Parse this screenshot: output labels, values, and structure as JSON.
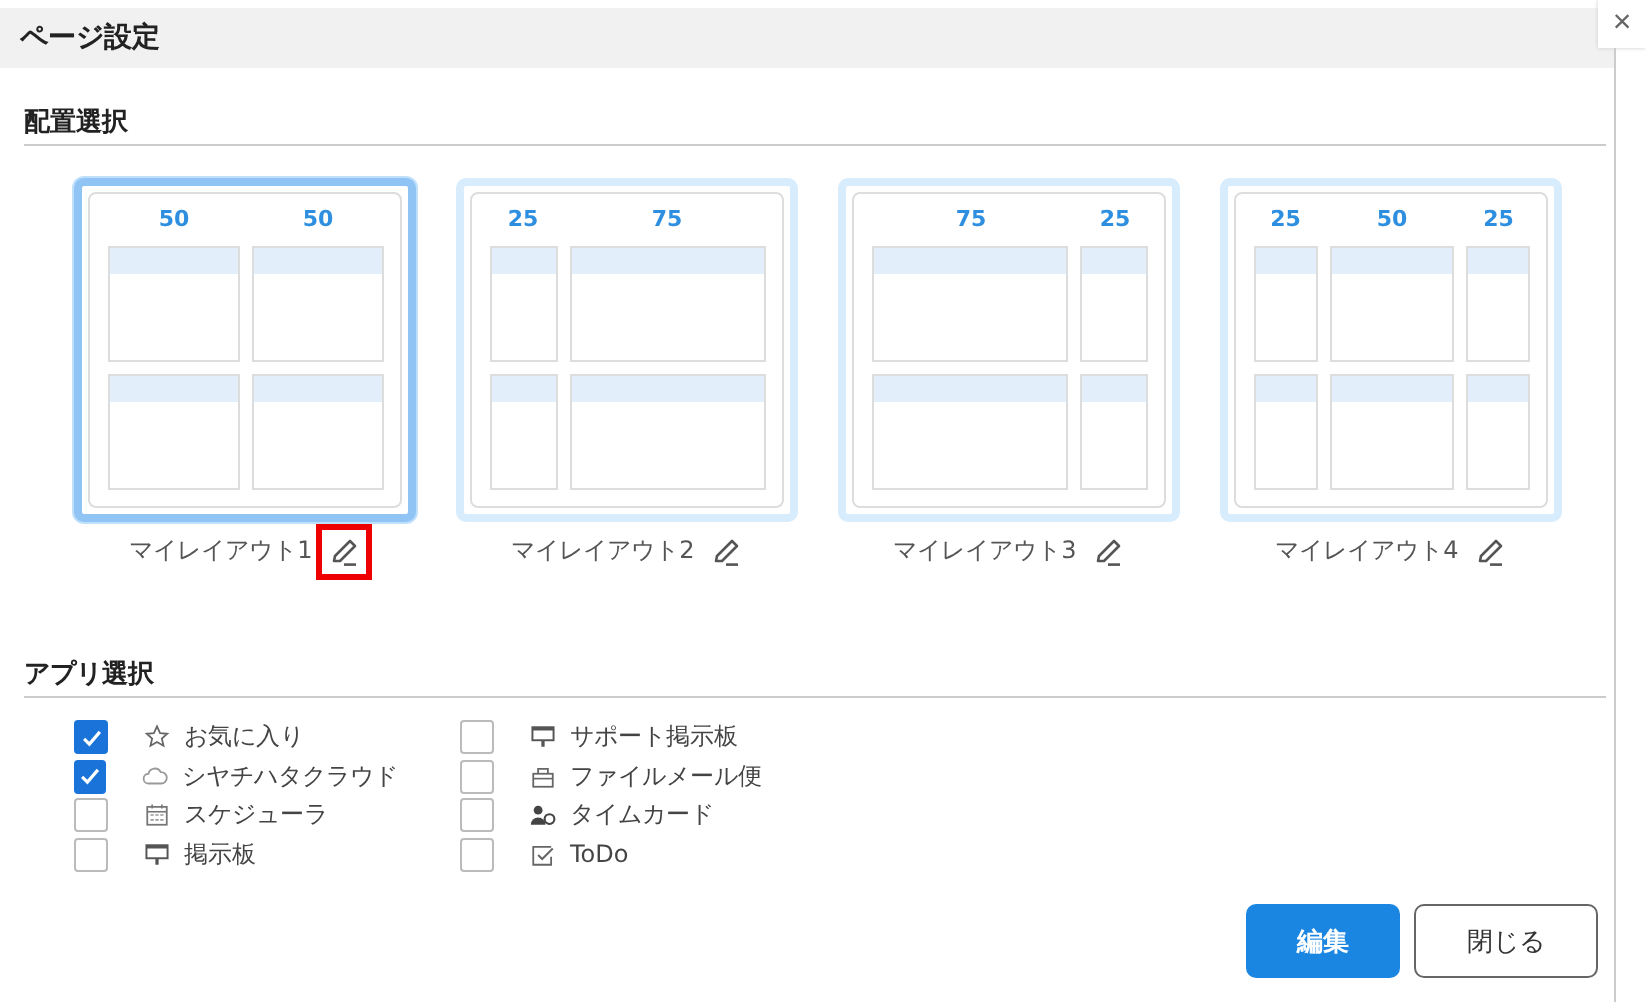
{
  "dialog": {
    "title": "ページ設定",
    "close": "×"
  },
  "layout_section": {
    "heading": "配置選択",
    "layouts": [
      {
        "name": "マイレイアウト1",
        "selected": true,
        "edit_highlighted": true,
        "columns": [
          "50",
          "50"
        ]
      },
      {
        "name": "マイレイアウト2",
        "selected": false,
        "edit_highlighted": false,
        "columns": [
          "25",
          "75"
        ]
      },
      {
        "name": "マイレイアウト3",
        "selected": false,
        "edit_highlighted": false,
        "columns": [
          "75",
          "25"
        ]
      },
      {
        "name": "マイレイアウト4",
        "selected": false,
        "edit_highlighted": false,
        "columns": [
          "25",
          "50",
          "25"
        ]
      }
    ]
  },
  "app_section": {
    "heading": "アプリ選択",
    "columns": [
      [
        {
          "label": "お気に入り",
          "checked": true
        },
        {
          "label": "シヤチハタクラウド",
          "checked": true
        },
        {
          "label": "スケジューラ",
          "checked": false
        },
        {
          "label": "掲示板",
          "checked": false
        }
      ],
      [
        {
          "label": "サポート掲示板",
          "checked": false
        },
        {
          "label": "ファイルメール便",
          "checked": false
        },
        {
          "label": "タイムカード",
          "checked": false
        },
        {
          "label": "ToDo",
          "checked": false
        }
      ]
    ]
  },
  "buttons": [
    {
      "label": "編集",
      "kind": "primary"
    },
    {
      "label": "閉じる",
      "kind": "secondary"
    }
  ]
}
